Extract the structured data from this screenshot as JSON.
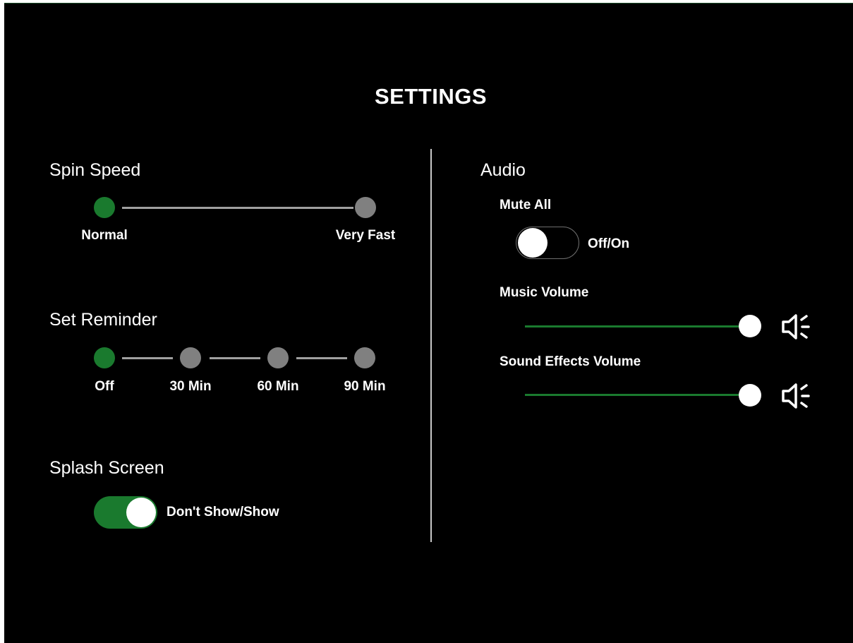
{
  "title": "SETTINGS",
  "spin_speed": {
    "title": "Spin Speed",
    "options": [
      "Normal",
      "Very Fast"
    ],
    "selected": "Normal"
  },
  "set_reminder": {
    "title": "Set Reminder",
    "options": [
      "Off",
      "30 Min",
      "60 Min",
      "90 Min"
    ],
    "selected": "Off"
  },
  "splash_screen": {
    "title": "Splash Screen",
    "toggle_label": "Don't Show/Show",
    "state": "on"
  },
  "audio": {
    "title": "Audio",
    "mute_all": {
      "label": "Mute All",
      "toggle_label": "Off/On",
      "state": "off"
    },
    "music_volume": {
      "label": "Music Volume",
      "level": 1.0,
      "icon": "speaker-icon"
    },
    "sound_effects_volume": {
      "label": "Sound Effects Volume",
      "level": 1.0,
      "icon": "speaker-icon"
    }
  },
  "colors": {
    "background": "#000000",
    "accent_green": "#1a7a2e",
    "inactive_dot": "#808080",
    "text": "#ffffff"
  }
}
